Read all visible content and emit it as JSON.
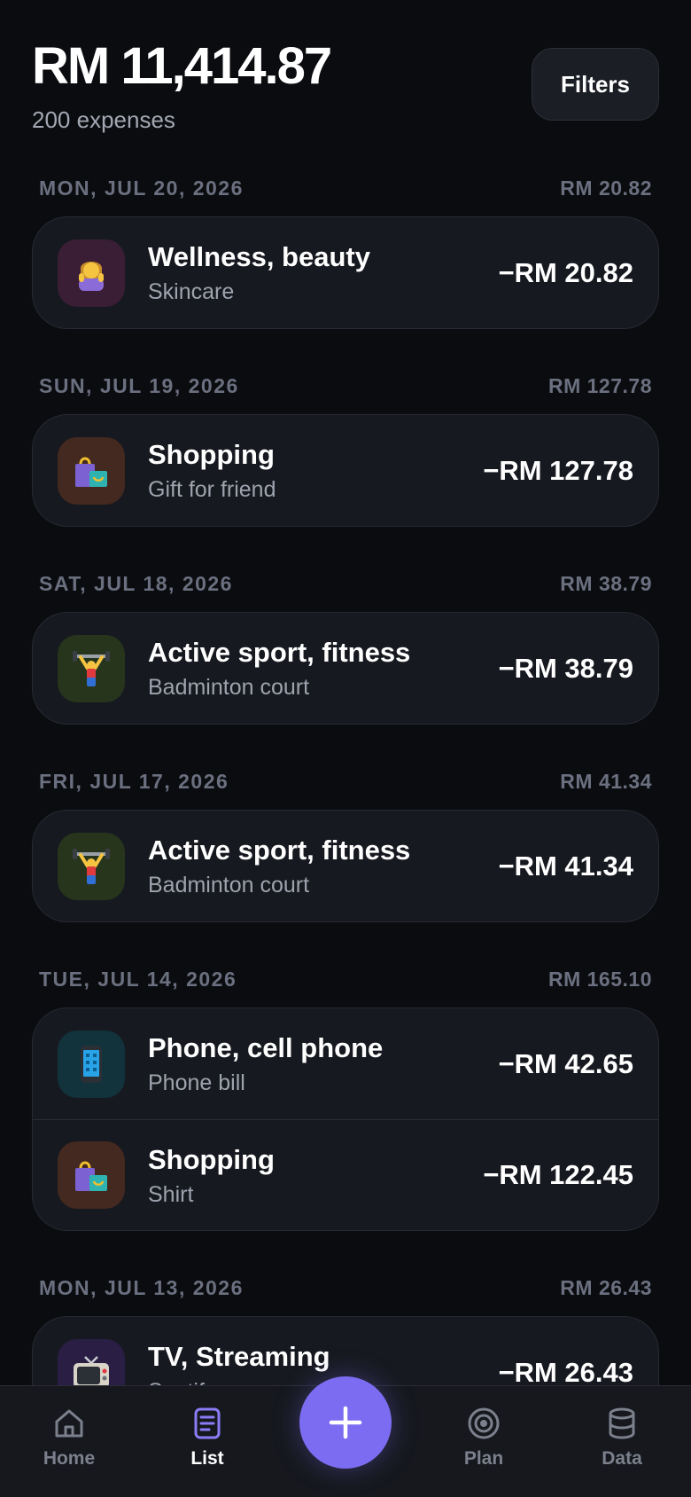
{
  "header": {
    "total": "RM 11,414.87",
    "count": "200 expenses",
    "filters_label": "Filters"
  },
  "days": [
    {
      "date": "MON, JUL 20, 2026",
      "sum": "RM 20.82",
      "items": [
        {
          "category": "Wellness, beauty",
          "note": "Skincare",
          "amount": "−RM 20.82",
          "icon": "woman-massage-icon",
          "color": "#3a1e35"
        }
      ]
    },
    {
      "date": "SUN, JUL 19, 2026",
      "sum": "RM 127.78",
      "items": [
        {
          "category": "Shopping",
          "note": "Gift for friend",
          "amount": "−RM 127.78",
          "icon": "shopping-bags-icon",
          "color": "#43291f"
        }
      ]
    },
    {
      "date": "SAT, JUL 18, 2026",
      "sum": "RM 38.79",
      "items": [
        {
          "category": "Active sport, fitness",
          "note": "Badminton court",
          "amount": "−RM 38.79",
          "icon": "weightlifter-icon",
          "color": "#26351c"
        }
      ]
    },
    {
      "date": "FRI, JUL 17, 2026",
      "sum": "RM 41.34",
      "items": [
        {
          "category": "Active sport, fitness",
          "note": "Badminton court",
          "amount": "−RM 41.34",
          "icon": "weightlifter-icon",
          "color": "#26351c"
        }
      ]
    },
    {
      "date": "TUE, JUL 14, 2026",
      "sum": "RM 165.10",
      "items": [
        {
          "category": "Phone, cell phone",
          "note": "Phone bill",
          "amount": "−RM 42.65",
          "icon": "mobile-phone-icon",
          "color": "#12323c"
        },
        {
          "category": "Shopping",
          "note": "Shirt",
          "amount": "−RM 122.45",
          "icon": "shopping-bags-icon",
          "color": "#43291f"
        }
      ]
    },
    {
      "date": "MON, JUL 13, 2026",
      "sum": "RM 26.43",
      "items": [
        {
          "category": "TV, Streaming",
          "note": "Spotify",
          "amount": "−RM 26.43",
          "icon": "television-icon",
          "color": "#2a1e45"
        }
      ]
    }
  ],
  "nav": {
    "home": "Home",
    "list": "List",
    "plan": "Plan",
    "data": "Data",
    "add": "add-icon"
  }
}
